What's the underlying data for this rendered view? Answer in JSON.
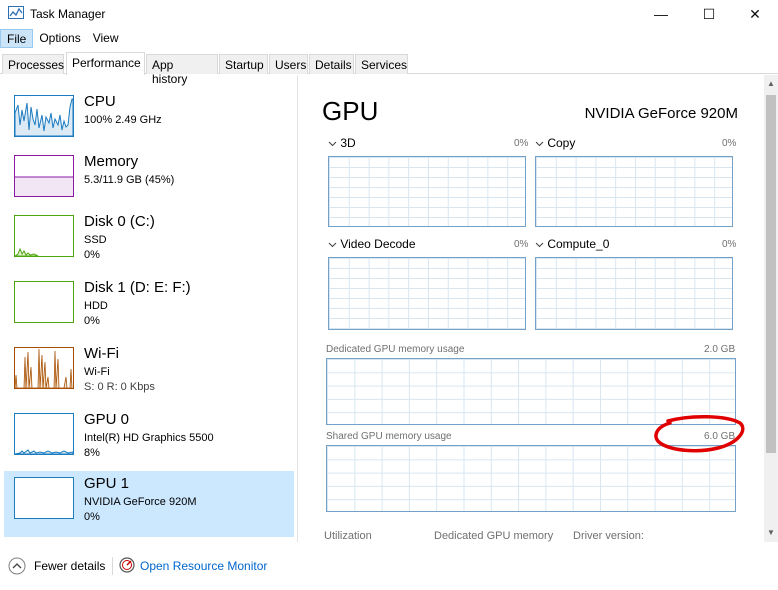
{
  "window": {
    "title": "Task Manager",
    "minimize_glyph": "—",
    "maximize_glyph": "☐",
    "close_glyph": "✕"
  },
  "menu": [
    "File",
    "Options",
    "View"
  ],
  "tabs": [
    "Processes",
    "Performance",
    "App history",
    "Startup",
    "Users",
    "Details",
    "Services"
  ],
  "sidebar": {
    "items": [
      {
        "name": "CPU",
        "lines": [
          "100%  2.49 GHz"
        ]
      },
      {
        "name": "Memory",
        "lines": [
          "5.3/11.9 GB (45%)"
        ]
      },
      {
        "name": "Disk 0 (C:)",
        "lines": [
          "SSD",
          "0%"
        ]
      },
      {
        "name": "Disk 1 (D: E: F:)",
        "lines": [
          "HDD",
          "0%"
        ]
      },
      {
        "name": "Wi-Fi",
        "lines": [
          "Wi-Fi",
          "S: 0  R: 0 Kbps"
        ]
      },
      {
        "name": "GPU 0",
        "lines": [
          "Intel(R) HD Graphics 5500",
          "8%"
        ]
      },
      {
        "name": "GPU 1",
        "lines": [
          "NVIDIA GeForce 920M",
          "0%"
        ]
      }
    ]
  },
  "main": {
    "title": "GPU",
    "model": "NVIDIA GeForce 920M",
    "engines": [
      {
        "label": "3D",
        "percent": "0%"
      },
      {
        "label": "Copy",
        "percent": "0%"
      },
      {
        "label": "Video Decode",
        "percent": "0%"
      },
      {
        "label": "Compute_0",
        "percent": "0%"
      }
    ],
    "dedicated": {
      "label": "Dedicated GPU memory usage",
      "max": "2.0 GB"
    },
    "shared": {
      "label": "Shared GPU memory usage",
      "max": "6.0 GB"
    },
    "stats": [
      "Utilization",
      "Dedicated GPU memory",
      "Driver version:"
    ]
  },
  "footer": {
    "fewer_details": "Fewer details",
    "open_resource_monitor": "Open Resource Monitor"
  },
  "colors": {
    "accent": "#0066cc",
    "selected": "#cce8ff",
    "cpu": "#1b7cc0",
    "memory": "#8b1aa1",
    "disk": "#4da60c",
    "wifi": "#a74f01",
    "gpu": "#1b7cc0",
    "annotation": "#e00000"
  },
  "icons": [
    "task-manager-icon",
    "chevron-down-icon",
    "chevron-up-icon",
    "resource-monitor-icon"
  ]
}
